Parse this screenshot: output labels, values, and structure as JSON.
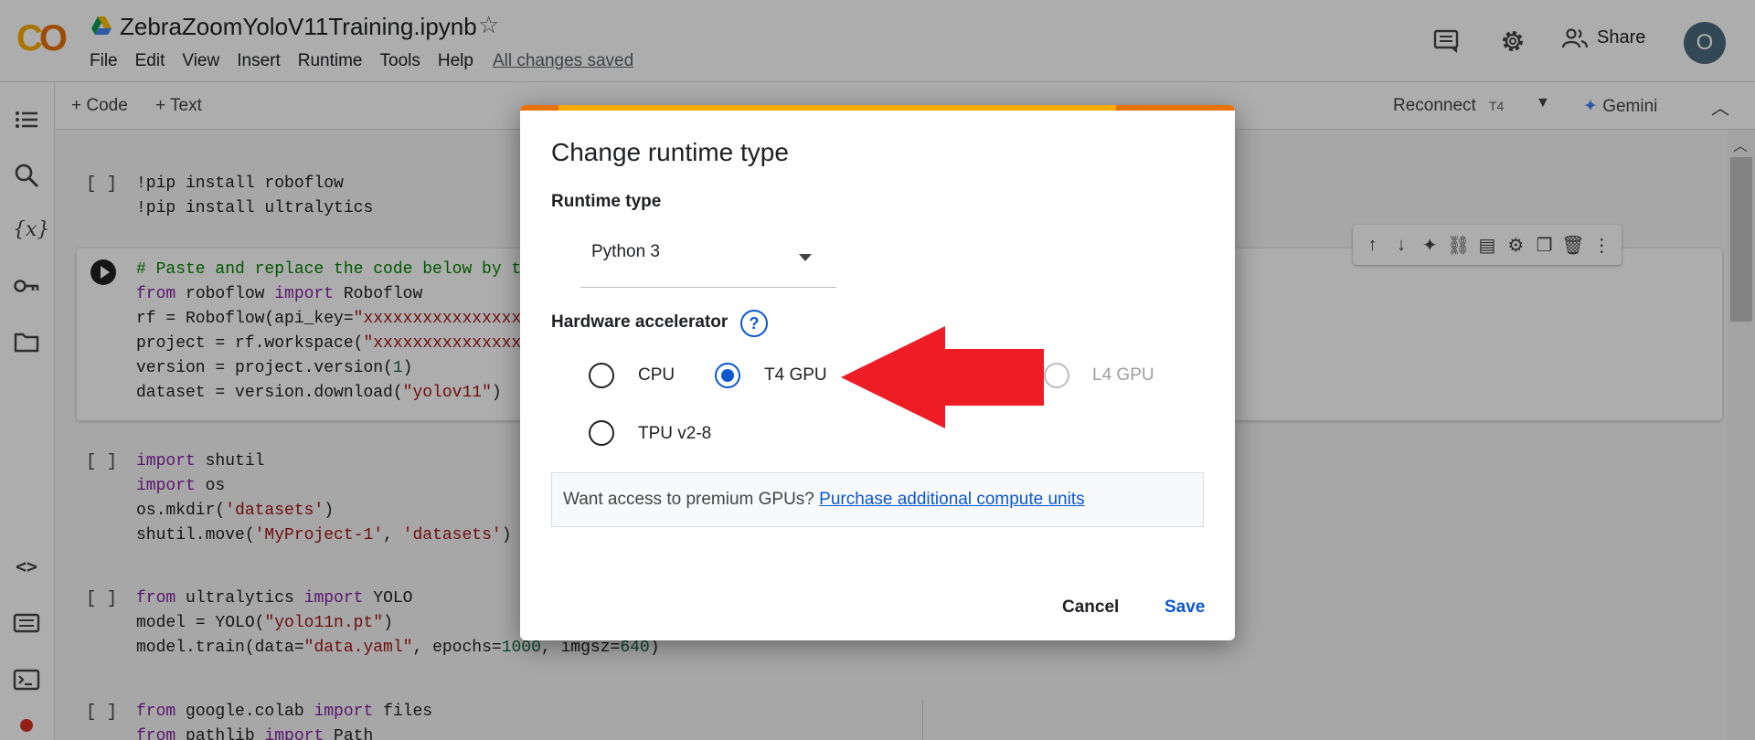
{
  "notebook": {
    "title": "ZebraZoomYoloV11Training.ipynb",
    "save_status": "All changes saved",
    "menu": [
      "File",
      "Edit",
      "View",
      "Insert",
      "Runtime",
      "Tools",
      "Help"
    ]
  },
  "header": {
    "share_label": "Share",
    "avatar_initial": "O"
  },
  "toolbar": {
    "add_code": "+ Code",
    "add_text": "+ Text",
    "reconnect": "Reconnect",
    "runtime_tag": "T4",
    "gemini": "Gemini"
  },
  "cells": [
    {
      "label": "[ ]",
      "lines": [
        "!pip install roboflow",
        "!pip install ultralytics"
      ]
    },
    {
      "label": "",
      "lines": [
        "# Paste and replace the code below by t",
        "from roboflow import Roboflow",
        "rf = Roboflow(api_key=\"xxxxxxxxxxxxxxxxx",
        "project = rf.workspace(\"xxxxxxxxxxxxxxx",
        "version = project.version(1)",
        "dataset = version.download(\"yolov11\")"
      ]
    },
    {
      "label": "[ ]",
      "lines": [
        "import shutil",
        "import os",
        "os.mkdir('datasets')",
        "shutil.move('MyProject-1', 'datasets')"
      ]
    },
    {
      "label": "[ ]",
      "lines": [
        "from ultralytics import YOLO",
        "model = YOLO(\"yolo11n.pt\")",
        "model.train(data=\"data.yaml\", epochs=1000, imgsz=640)"
      ]
    },
    {
      "label": "[ ]",
      "lines": [
        "from google.colab import files",
        "from pathlib import Path"
      ]
    }
  ],
  "dialog": {
    "title": "Change runtime type",
    "runtime_type_label": "Runtime type",
    "runtime_type_value": "Python 3",
    "hardware_label": "Hardware accelerator",
    "help": "?",
    "options": [
      {
        "label": "CPU",
        "checked": false,
        "disabled": false
      },
      {
        "label": "T4 GPU",
        "checked": true,
        "disabled": false
      },
      {
        "label": "L4 GPU",
        "checked": false,
        "disabled": true
      },
      {
        "label": "TPU v2-8",
        "checked": false,
        "disabled": false
      }
    ],
    "promo_text": "Want access to premium GPUs?",
    "promo_link": "Purchase additional compute units",
    "cancel_label": "Cancel",
    "save_label": "Save"
  },
  "colors": {
    "accent": "#0b57d0",
    "arrow": "#ee1c25",
    "colab_orange": "#e8710a",
    "colab_yellow": "#f9ab00"
  },
  "icons": [
    "drive-icon",
    "star-icon",
    "comment-icon",
    "gear-icon",
    "people-icon",
    "toc-icon",
    "search-icon",
    "variables-icon",
    "key-icon",
    "folder-icon",
    "code-snippets-icon",
    "command-palette-icon",
    "terminal-icon",
    "help-circle-icon",
    "red-arrow-icon"
  ]
}
